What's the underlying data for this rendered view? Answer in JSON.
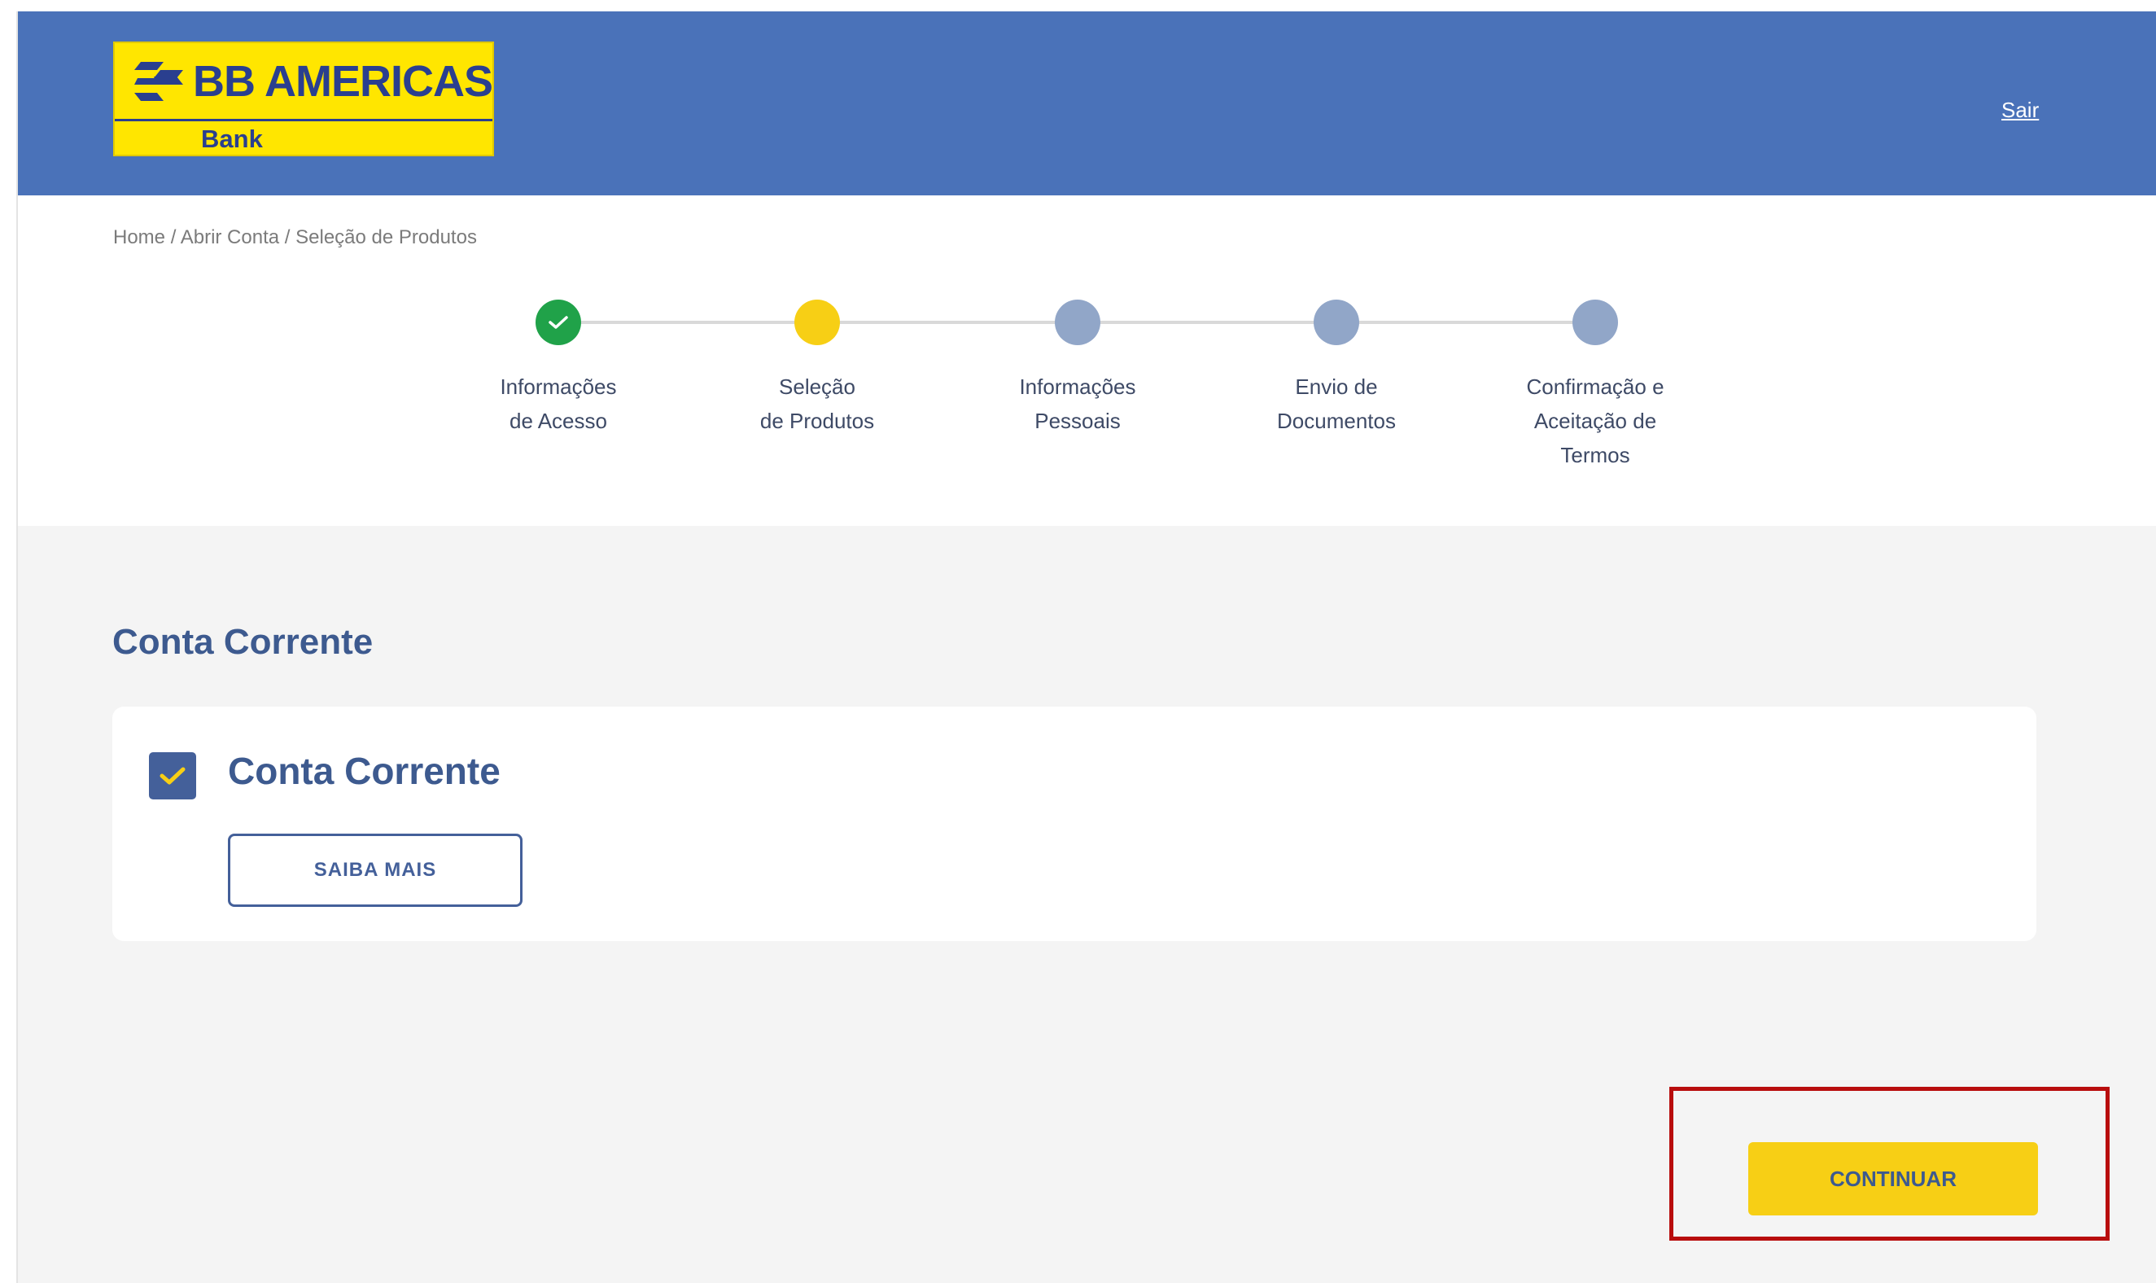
{
  "header": {
    "logo": {
      "name": "BB AMERICAS",
      "subtitle": "Bank"
    },
    "logout_label": "Sair"
  },
  "breadcrumb": {
    "items": [
      "Home",
      "Abrir Conta",
      "Seleção de Produtos"
    ],
    "separator": " / "
  },
  "stepper": {
    "steps": [
      {
        "label": "Informações\nde Acesso",
        "status": "done"
      },
      {
        "label": "Seleção\nde Produtos",
        "status": "current"
      },
      {
        "label": "Informações\nPessoais",
        "status": "todo"
      },
      {
        "label": "Envio de\nDocumentos",
        "status": "todo"
      },
      {
        "label": "Confirmação e\nAceitação de\nTermos",
        "status": "todo"
      }
    ]
  },
  "main": {
    "section_title": "Conta Corrente",
    "product": {
      "title": "Conta Corrente",
      "checked": true,
      "more_button": "SAIBA MAIS"
    },
    "continue_button": "CONTINUAR"
  },
  "colors": {
    "header_bg": "#4a72b9",
    "logo_bg": "#ffe600",
    "brand_blue": "#3d5a8f",
    "step_done": "#20a249",
    "step_current": "#f7cf15",
    "step_todo": "#91a6c8",
    "continue_bg": "#f7cf15",
    "highlight_border": "#b80d0d"
  }
}
